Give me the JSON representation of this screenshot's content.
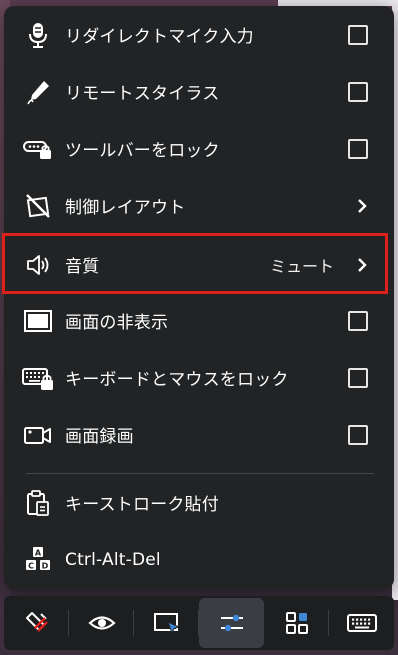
{
  "menu": {
    "items": [
      {
        "label": "リダイレクトマイク入力",
        "icon": "microphone-icon",
        "control": "checkbox",
        "checked": false
      },
      {
        "label": "リモートスタイラス",
        "icon": "stylus-pen-icon",
        "control": "checkbox",
        "checked": false
      },
      {
        "label": "ツールバーをロック",
        "icon": "toolbar-lock-icon",
        "control": "checkbox",
        "checked": false
      },
      {
        "label": "制御レイアウト",
        "icon": "control-layout-icon",
        "control": "submenu"
      },
      {
        "label": "音質",
        "value": "ミュート",
        "icon": "speaker-icon",
        "control": "submenu",
        "highlighted": true
      },
      {
        "label": "画面の非表示",
        "icon": "blank-screen-icon",
        "control": "checkbox",
        "checked": false
      },
      {
        "label": "キーボードとマウスをロック",
        "icon": "keyboard-mouse-lock-icon",
        "control": "checkbox",
        "checked": false
      },
      {
        "label": "画面録画",
        "icon": "video-camera-icon",
        "control": "checkbox",
        "checked": false
      },
      {
        "label": "キーストローク貼付",
        "icon": "clipboard-paste-icon",
        "control": "action"
      },
      {
        "label": "Ctrl-Alt-Del",
        "icon": "ctrl-alt-del-keys-icon",
        "control": "action"
      }
    ]
  },
  "toolbar": {
    "buttons": [
      {
        "icon": "disconnect-icon",
        "active": false
      },
      {
        "icon": "eye-icon",
        "active": false
      },
      {
        "icon": "screen-cursor-icon",
        "active": false
      },
      {
        "icon": "sliders-icon",
        "active": true
      },
      {
        "icon": "grid-apps-icon",
        "active": false
      },
      {
        "icon": "keyboard-icon",
        "active": false
      }
    ]
  },
  "colors": {
    "menu_bg": "#212325",
    "highlight": "#e0201a",
    "text": "#ffffff",
    "accent_blue": "#3f86d6"
  }
}
